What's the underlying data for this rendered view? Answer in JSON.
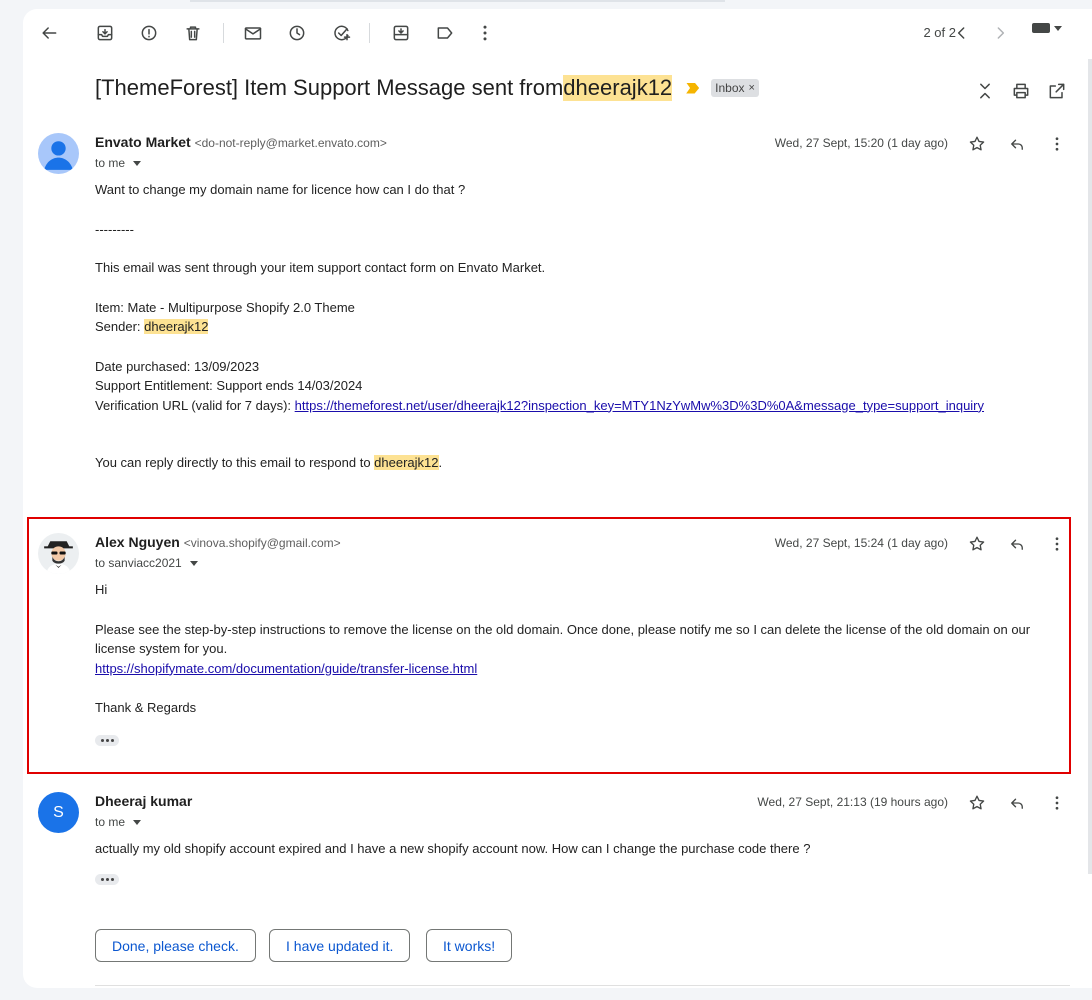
{
  "toolbar": {
    "pager_text": "2 of 2",
    "icons": [
      "back-arrow-icon",
      "archive-icon",
      "report-spam-icon",
      "delete-icon",
      "mark-unread-icon",
      "snooze-icon",
      "add-task-icon",
      "move-to-icon",
      "label-icon",
      "more-vert-icon",
      "newer-chevron-icon",
      "older-chevron-icon",
      "keyboard-icon"
    ]
  },
  "subject": {
    "prefix": "[ThemeForest] Item Support Message sent from ",
    "highlight": "dheerajk12",
    "label": "Inbox",
    "label_close": "×"
  },
  "messages": [
    {
      "sender_name": "Envato Market",
      "sender_addr": "<do-not-reply@market.envato.com>",
      "to": "to me",
      "date": "Wed, 27 Sept, 15:20 (1 day ago)",
      "lines": {
        "l1": "Want to change my domain name for licence how can I do that ?",
        "l2": "---------",
        "l3": "This email was sent through your item support contact form on Envato Market.",
        "l4": "Item: Mate - Multipurpose Shopify 2.0 Theme",
        "l5_prefix": "Sender: ",
        "l5_hl": "dheerajk12",
        "l6": "Date purchased: 13/09/2023",
        "l7": "Support Entitlement: Support ends 14/03/2024",
        "l8_prefix": "Verification URL (valid for 7 days): ",
        "l8_link": "https://themeforest.net/user/dheerajk12?inspection_key=MTY1NzYwMw%3D%3D%0A&message_type=support_inquiry",
        "l9_prefix": "You can reply directly to this email to respond to ",
        "l9_hl": "dheerajk12",
        "l9_suffix": "."
      }
    },
    {
      "sender_name": "Alex Nguyen",
      "sender_addr": "<vinova.shopify@gmail.com>",
      "to": "to sanviacc2021",
      "date": "Wed, 27 Sept, 15:24 (1 day ago)",
      "lines": {
        "l1": "Hi",
        "l2": "Please see the step-by-step instructions to remove the license on the old domain. Once done, please notify me so I can delete the license of the old domain on our license system for you.",
        "l3_link": "https://shopifymate.com/documentation/guide/transfer-license.html",
        "l4": "Thank & Regards"
      }
    },
    {
      "sender_name": "Dheeraj kumar",
      "avatar_letter": "S",
      "to": "to me",
      "date": "Wed, 27 Sept, 21:13 (19 hours ago)",
      "lines": {
        "l1": "actually my old shopify account expired and I have a new shopify account now. How can I change the purchase code there ?"
      }
    }
  ],
  "smart_replies": [
    "Done, please check.",
    "I have updated it.",
    "It works!"
  ],
  "colors": {
    "highlight": "#fde293",
    "link": "#1a0dab",
    "smart_reply_text": "#0b57d0",
    "selection_box": "#e00000",
    "avatar_blue": "#1a73e8",
    "important_marker": "#f5b400"
  }
}
